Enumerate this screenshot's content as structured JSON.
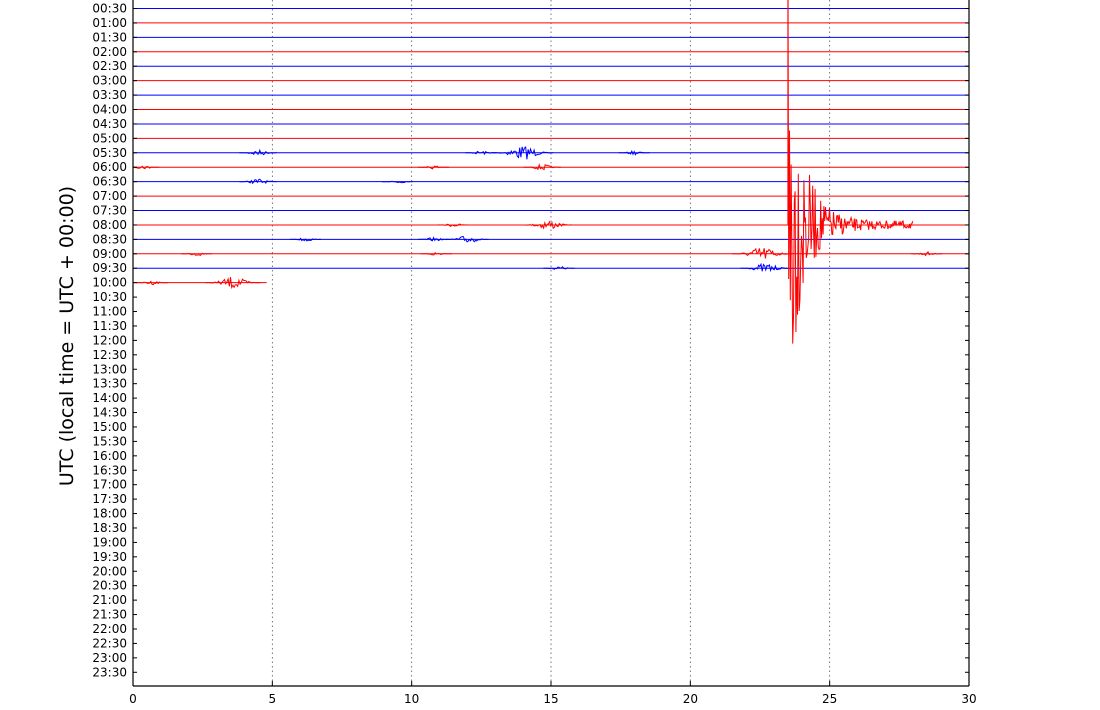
{
  "chart_data": {
    "type": "line",
    "ylabel": "UTC (local time = UTC + 00:00)",
    "xlim": [
      0,
      30
    ],
    "x_ticks": [
      "0",
      "5",
      "10",
      "15",
      "20",
      "25",
      "30"
    ],
    "x_gridlines": [
      5,
      10,
      15,
      20,
      25
    ],
    "grid": "dotted vertical",
    "row_labels": [
      "00:30",
      "01:00",
      "01:30",
      "02:00",
      "02:30",
      "03:00",
      "03:30",
      "04:00",
      "04:30",
      "05:00",
      "05:30",
      "06:00",
      "06:30",
      "07:00",
      "07:30",
      "08:00",
      "08:30",
      "09:00",
      "09:30",
      "10:00",
      "10:30",
      "11:00",
      "11:30",
      "12:00",
      "12:30",
      "13:00",
      "13:30",
      "14:00",
      "14:30",
      "15:00",
      "15:30",
      "16:00",
      "16:30",
      "17:00",
      "17:30",
      "18:00",
      "18:30",
      "19:00",
      "19:30",
      "20:00",
      "20:30",
      "21:00",
      "21:30",
      "22:00",
      "22:30",
      "23:00",
      "23:30"
    ],
    "row_colors": {
      "on_the_hour": "#ff0000",
      "half_hour": "#0000ff"
    },
    "traces_recorded_until": {
      "row": "10:00",
      "x": 4.8
    },
    "events": [
      {
        "row": "05:30",
        "x": 4.5,
        "amp": 3
      },
      {
        "row": "05:30",
        "x": 12.5,
        "amp": 2
      },
      {
        "row": "05:30",
        "x": 14.0,
        "amp": 7
      },
      {
        "row": "05:30",
        "x": 18.0,
        "amp": 2
      },
      {
        "row": "06:00",
        "x": 0.4,
        "amp": 2
      },
      {
        "row": "06:00",
        "x": 10.8,
        "amp": 2
      },
      {
        "row": "06:00",
        "x": 14.7,
        "amp": 3
      },
      {
        "row": "06:30",
        "x": 4.5,
        "amp": 3
      },
      {
        "row": "06:30",
        "x": 9.5,
        "amp": 2
      },
      {
        "row": "08:00",
        "x": 14.9,
        "amp": 5
      },
      {
        "row": "08:00",
        "x": 11.5,
        "amp": 2
      },
      {
        "row": "08:30",
        "x": 6.2,
        "amp": 2
      },
      {
        "row": "08:30",
        "x": 12.0,
        "amp": 4
      },
      {
        "row": "08:30",
        "x": 10.8,
        "amp": 2
      },
      {
        "row": "09:00",
        "x": 2.3,
        "amp": 2
      },
      {
        "row": "09:00",
        "x": 10.9,
        "amp": 2
      },
      {
        "row": "09:00",
        "x": 22.6,
        "amp": 7
      },
      {
        "row": "09:00",
        "x": 28.5,
        "amp": 2
      },
      {
        "row": "09:30",
        "x": 15.3,
        "amp": 2
      },
      {
        "row": "09:30",
        "x": 22.7,
        "amp": 5
      },
      {
        "row": "10:00",
        "x": 0.7,
        "amp": 2
      },
      {
        "row": "10:00",
        "x": 3.6,
        "amp": 6
      }
    ],
    "earthquake": {
      "row": "08:00",
      "x": 23.5,
      "coda_until": 28.0,
      "offscale": true
    }
  }
}
